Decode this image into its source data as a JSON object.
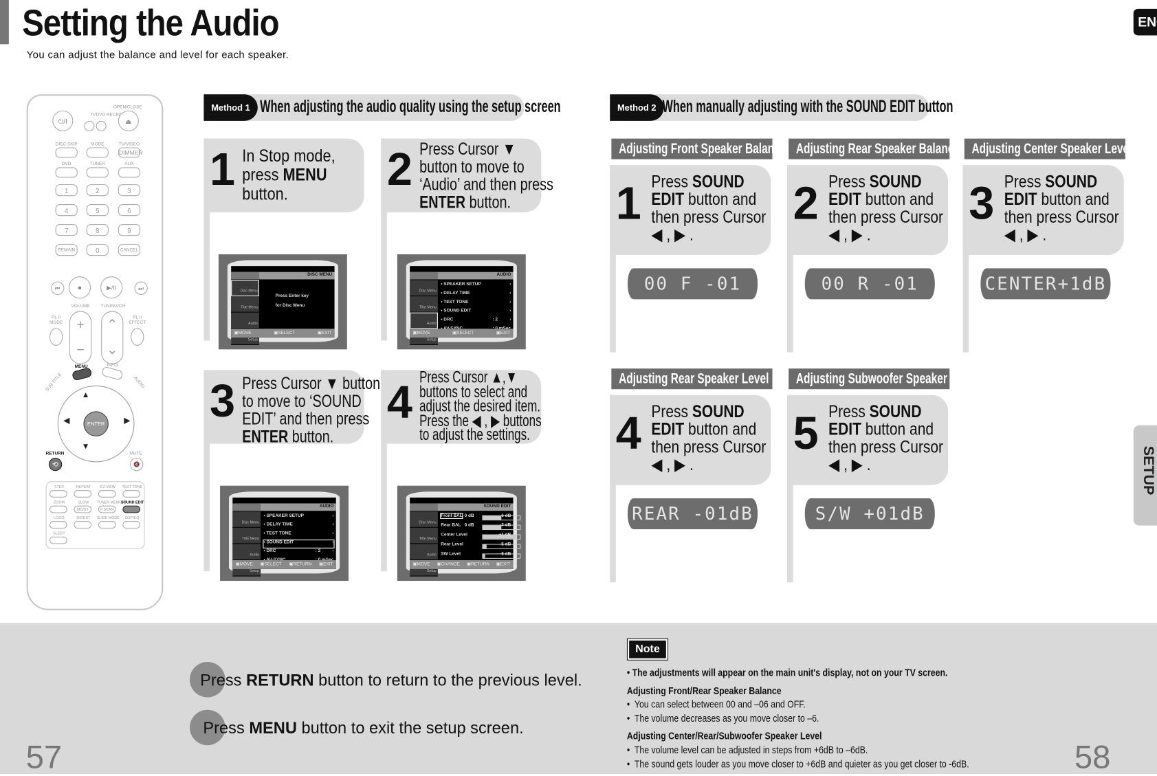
{
  "header": {
    "title": "Setting the Audio",
    "subtitle": "You can adjust the balance and level for each speaker.",
    "lang_tab": "ENG",
    "section_tab": "SETUP"
  },
  "remote": {
    "top": {
      "power": "⏻/I",
      "tv": "TV",
      "dvd_receiver": "DVD RECEIVER",
      "open_close": "OPEN/CLOSE",
      "eject": "⏏"
    },
    "rows": [
      [
        "DISC SKIP",
        "MODE",
        "TV/VIDEO"
      ],
      [
        "DVD",
        "TUNER",
        "AUX"
      ]
    ],
    "dimmer": "DIMMER",
    "keypad": [
      [
        "1",
        "2",
        "3"
      ],
      [
        "4",
        "5",
        "6"
      ],
      [
        "7",
        "8",
        "9"
      ],
      [
        "REMAIN",
        "0",
        "CANCEL"
      ]
    ],
    "transport": [
      "⏮",
      "■",
      "▶/II",
      "⏭"
    ],
    "volume": "VOLUME",
    "tuning": "TUNING/CH",
    "pl_mode": "PL II MODE",
    "pl_effect": "PL II EFFECT",
    "menu": "MENU",
    "info": "INFO",
    "subtitle": "SUB TITLE",
    "audio": "AUDIO",
    "enter": "ENTER",
    "return": "RETURN",
    "mute": "MUTE",
    "bottom_grid": [
      [
        "STEP",
        "REPEAT",
        "EZ VIEW",
        "TEST TONE"
      ],
      [
        "ZOOM",
        "SLOW",
        "TUNER MEMORY",
        "SOUND EDIT"
      ],
      [
        "LOGO",
        "DIGEST",
        "SLIDE MODE",
        "DSP/EQ"
      ],
      [
        "SLEEP"
      ]
    ],
    "bottom_sub": {
      "slow": "MO/ST",
      "tuner_memory": "P.SCAN"
    }
  },
  "method1": {
    "badge": "Method 1",
    "title": "When adjusting the audio quality using the setup screen",
    "steps": [
      {
        "number": "1",
        "text": [
          [
            "In Stop mode,\n",
            false
          ],
          [
            "press ",
            false
          ],
          [
            "MENU",
            true
          ],
          [
            "\nbutton.",
            false
          ]
        ]
      },
      {
        "number": "2",
        "text": [
          [
            "Press Cursor ▼\nbutton to move to\n‘Audio’ and then press\n",
            false
          ],
          [
            "ENTER",
            true
          ],
          [
            " button.",
            false
          ]
        ]
      },
      {
        "number": "3",
        "text": [
          [
            "Press Cursor ▼ button\nto move to ‘SOUND\nEDIT’ and then press\n",
            false
          ],
          [
            "ENTER",
            true
          ],
          [
            " button.",
            false
          ]
        ]
      },
      {
        "number": "4",
        "text": [
          [
            "Press Cursor  ▲,▼\nbuttons to select and\nadjust the desired item.\nPress the  ◀ , ▶  buttons\nto adjust the settings.",
            false
          ]
        ]
      }
    ],
    "screens": [
      {
        "header": "DISC MENU",
        "side": [
          "Disc Menu",
          "Title Menu",
          "Audio",
          "Setup"
        ],
        "side_sel": 0,
        "rows": [],
        "message": [
          "Press Enter key",
          "for Disc Menu"
        ],
        "footer": [
          "MOVE",
          "SELECT",
          "EXIT"
        ]
      },
      {
        "header": "AUDIO",
        "side": [
          "Disc Menu",
          "Title Menu",
          "Audio",
          "Setup"
        ],
        "side_sel": 2,
        "rows": [
          [
            "• SPEAKER SETUP",
            "",
            "›"
          ],
          [
            "• DELAY TIME",
            "",
            "›"
          ],
          [
            "• TEST TONE",
            "",
            "›"
          ],
          [
            "• SOUND EDIT",
            "",
            "›"
          ],
          [
            "• DRC",
            ": 2",
            "›"
          ],
          [
            "• AV-SYNC",
            ": 0 mSec",
            ""
          ]
        ],
        "row_sel": -1,
        "footer": [
          "MOVE",
          "SELECT",
          "EXIT"
        ]
      },
      {
        "header": "AUDIO",
        "side": [
          "Disc Menu",
          "Title Menu",
          "Audio",
          "Setup"
        ],
        "side_sel": -1,
        "rows": [
          [
            "• SPEAKER SETUP",
            "",
            "›"
          ],
          [
            "• DELAY TIME",
            "",
            "›"
          ],
          [
            "• TEST TONE",
            "",
            "›"
          ],
          [
            "• SOUND EDIT",
            "",
            "›"
          ],
          [
            "• DRC",
            ": 2",
            "›"
          ],
          [
            "• AV-SYNC",
            ": 0 mSec",
            ""
          ]
        ],
        "row_sel": 3,
        "footer": [
          "MOVE",
          "SELECT",
          "RETURN",
          "EXIT"
        ]
      },
      {
        "header": "SOUND EDIT",
        "side": [
          "Disc Menu",
          "Title Menu",
          "Audio",
          "Setup"
        ],
        "side_sel": -1,
        "rows": [
          [
            "Front BAL",
            "0 dB",
            "-6 dB"
          ],
          [
            "Rear BAL",
            "0 dB",
            "-3 dB"
          ],
          [
            "Center Level",
            "",
            "+1 dB"
          ],
          [
            "Rear Level",
            "",
            "-5 dB"
          ],
          [
            "SW Level",
            "",
            "-6 dB"
          ]
        ],
        "row_sel": 0,
        "sliders": [
          0.5,
          0.5,
          0.9,
          0.1,
          0.05
        ],
        "footer": [
          "MOVE",
          "CHANGE",
          "RETURN",
          "EXIT"
        ]
      }
    ]
  },
  "method2": {
    "badge": "Method 2",
    "title": "When manually adjusting with the SOUND EDIT button",
    "sections": [
      {
        "label": "Adjusting Front Speaker Balance",
        "number": "1",
        "display": "00 F  -01"
      },
      {
        "label": "Adjusting Rear Speaker Balance",
        "number": "2",
        "display": "00 R  -01"
      },
      {
        "label": "Adjusting Center Speaker Level",
        "number": "3",
        "display": "CENTER+1dB"
      },
      {
        "label": "Adjusting Rear Speaker Level",
        "number": "4",
        "display": "REAR -01dB"
      },
      {
        "label": "Adjusting Subwoofer Speaker Level",
        "number": "5",
        "display": "S/W  +01dB"
      }
    ],
    "step_text": [
      [
        "Press ",
        false
      ],
      [
        "SOUND\nEDIT",
        true
      ],
      [
        " button and\nthen press Cursor\n◀ , ▶ .",
        false
      ]
    ]
  },
  "bottom": {
    "return_text": [
      [
        "Press ",
        false
      ],
      [
        "RETURN",
        true
      ],
      [
        " button to return to the previous level.",
        false
      ]
    ],
    "menu_text": [
      [
        "Press ",
        false
      ],
      [
        "MENU",
        true
      ],
      [
        " button to exit the setup screen.",
        false
      ]
    ]
  },
  "note": {
    "label": "Note",
    "main": "• The adjustments will appear on the main unit's display, not on your TV screen.",
    "sub1_title": "Adjusting Front/Rear Speaker Balance",
    "sub1_items": [
      "You can select between 00 and –06 and OFF.",
      "The volume decreases as you move closer to –6."
    ],
    "sub2_title": "Adjusting Center/Rear/Subwoofer Speaker Level",
    "sub2_items": [
      "The volume level can be adjusted in steps from +6dB to –6dB.",
      "The sound gets louder as you move closer to +6dB and quieter as you get closer to -6dB."
    ]
  },
  "page_numbers": {
    "left": "57",
    "right": "58"
  },
  "colors": {
    "panel": "#dcdcdc",
    "label_bg": "#6b6b6b",
    "lcd": "#6d6d6d",
    "badge": "#111111",
    "footer_bg": "#d9d9d9"
  }
}
